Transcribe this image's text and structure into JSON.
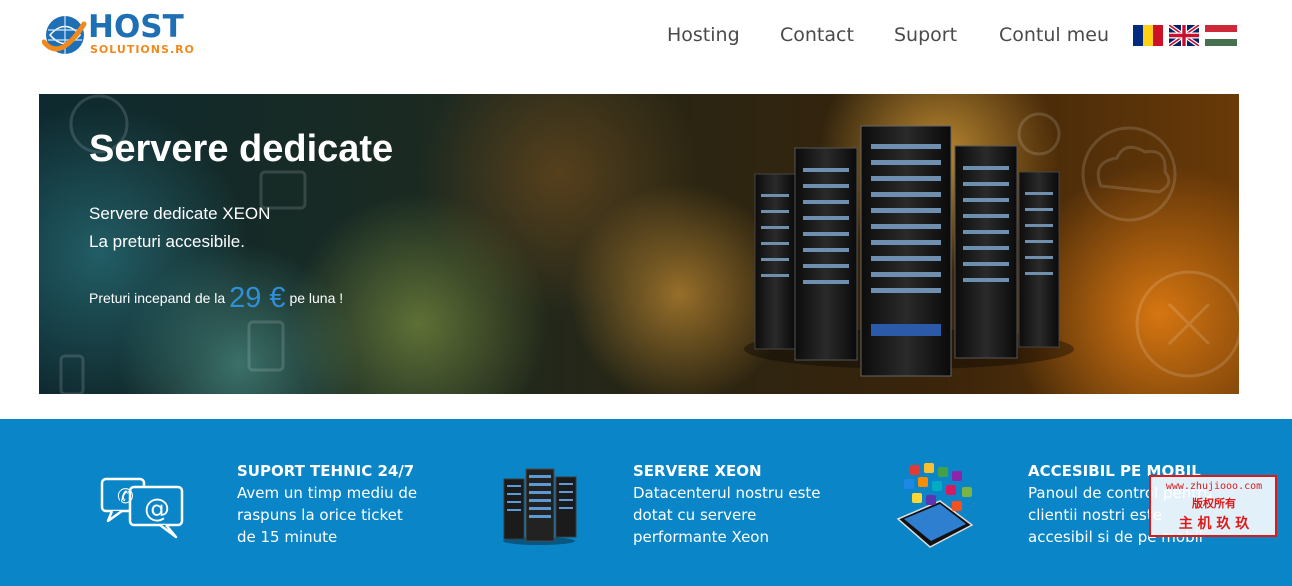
{
  "logo": {
    "brand": "HOST",
    "sub": "SOLUTIONS.RO"
  },
  "nav": {
    "items": [
      {
        "label": "Hosting"
      },
      {
        "label": "Contact"
      },
      {
        "label": "Suport"
      },
      {
        "label": "Contul meu"
      }
    ]
  },
  "languages": [
    {
      "name": "Romanian flag"
    },
    {
      "name": "English flag"
    },
    {
      "name": "Hungarian flag"
    }
  ],
  "banner": {
    "title": "Servere dedicate",
    "line1": "Servere dedicate XEON",
    "line2": "La preturi accesibile.",
    "price_prefix": "Preturi incepand de la",
    "price_amount": "29 €",
    "price_suffix": "pe luna !"
  },
  "features": [
    {
      "icon": "chat-bubbles-icon",
      "title": "SUPORT TEHNIC 24/7",
      "lines": [
        "Avem un timp mediu de",
        "raspuns la orice ticket",
        "de 15 minute"
      ]
    },
    {
      "icon": "server-rack-icon",
      "title": "SERVERE XEON",
      "lines": [
        "Datacenterul nostru este",
        "dotat cu servere",
        "performante Xeon"
      ]
    },
    {
      "icon": "smartphone-apps-icon",
      "title": "ACCESIBIL PE MOBIL",
      "lines": [
        "Panoul de control pentru",
        "clientii nostri este",
        "accesibil si de pe mobil"
      ]
    }
  ],
  "watermark": {
    "url": "www.zhujiooo.com",
    "line1": "版权所有",
    "line2": "主 机 玖 玖"
  },
  "colors": {
    "brand_blue": "#1f6fb5",
    "brand_orange": "#f08a1c",
    "feature_band": "#0a86c8",
    "price_blue": "#2f8fd8"
  }
}
